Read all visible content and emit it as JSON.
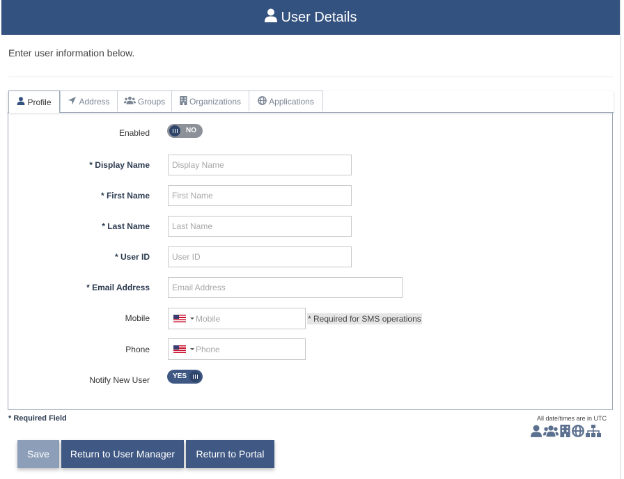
{
  "header": {
    "title": "User Details",
    "icon": "user-icon"
  },
  "intro": "Enter user information below.",
  "tabs": [
    {
      "label": "Profile",
      "icon": "user-icon",
      "active": true
    },
    {
      "label": "Address",
      "icon": "location-arrow-icon",
      "active": false
    },
    {
      "label": "Groups",
      "icon": "users-icon",
      "active": false
    },
    {
      "label": "Organizations",
      "icon": "building-icon",
      "active": false
    },
    {
      "label": "Applications",
      "icon": "globe-icon",
      "active": false
    }
  ],
  "form": {
    "enabled": {
      "label": "Enabled",
      "state": "NO"
    },
    "display_name": {
      "label": "* Display Name",
      "placeholder": "Display Name",
      "value": ""
    },
    "first_name": {
      "label": "* First Name",
      "placeholder": "First Name",
      "value": ""
    },
    "last_name": {
      "label": "* Last Name",
      "placeholder": "Last Name",
      "value": ""
    },
    "user_id": {
      "label": "* User ID",
      "placeholder": "User ID",
      "value": ""
    },
    "email": {
      "label": "* Email Address",
      "placeholder": "Email Address",
      "value": ""
    },
    "mobile": {
      "label": "Mobile",
      "placeholder": "Mobile",
      "country": "us-flag-icon",
      "note": "* Required for SMS operations"
    },
    "phone": {
      "label": "Phone",
      "placeholder": "Phone",
      "country": "us-flag-icon"
    },
    "notify": {
      "label": "Notify New User",
      "state": "YES"
    }
  },
  "footer": {
    "required_note": "* Required Field",
    "utc_note": "All date/times are in UTC",
    "legend_icons": [
      "user-icon",
      "users-icon",
      "building-icon",
      "globe-icon",
      "sitemap-icon"
    ]
  },
  "buttons": {
    "save": "Save",
    "return_user_manager": "Return to User Manager",
    "return_portal": "Return to Portal"
  },
  "colors": {
    "header": "#34527f",
    "toggle_on": "#3e5883",
    "toggle_off": "#8c9099",
    "button": "#3f5884",
    "button_disabled": "#8d9eb8"
  }
}
